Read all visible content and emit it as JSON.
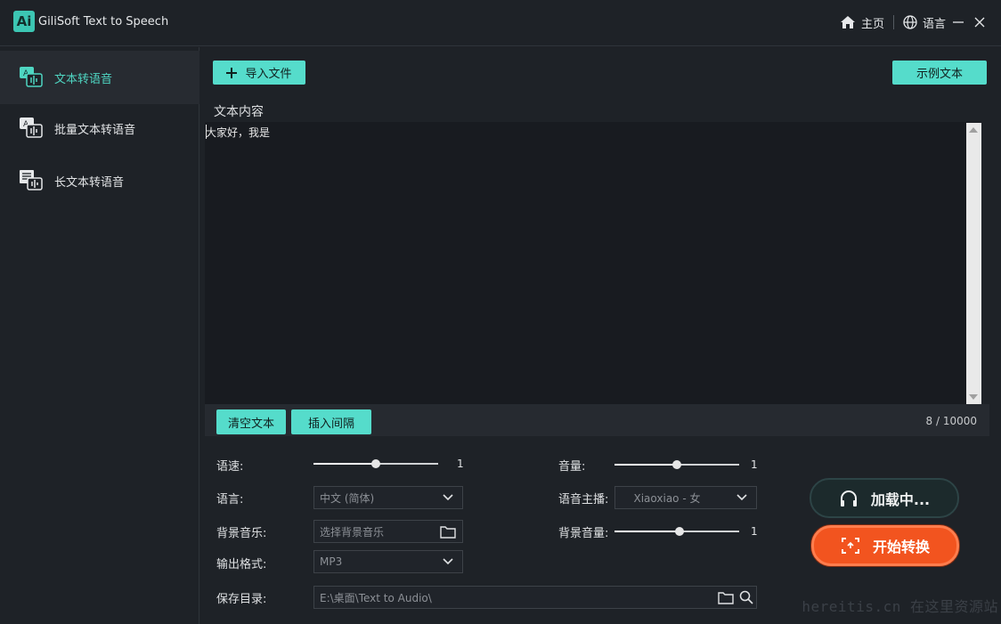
{
  "app": {
    "logo_text": "Ai",
    "title": "GiliSoft Text to Speech"
  },
  "titlebar": {
    "home_label": "主页",
    "language_label": "语言",
    "minimize_glyph": "—",
    "close_glyph": "✕"
  },
  "sidebar": {
    "items": [
      {
        "label": "文本转语音",
        "active": true
      },
      {
        "label": "批量文本转语音",
        "active": false
      },
      {
        "label": "长文本转语音",
        "active": false
      }
    ]
  },
  "toolbar": {
    "import_label": "导入文件",
    "sample_label": "示例文本"
  },
  "editor": {
    "section_label": "文本内容",
    "text": "大家好，我是",
    "clear_label": "清空文本",
    "insert_pause_label": "插入间隔",
    "counter": "8 / 10000",
    "counter_max": 10000,
    "counter_value": 8
  },
  "settings": {
    "speed": {
      "label": "语速:",
      "value": "1",
      "fraction": 0.5
    },
    "volume": {
      "label": "音量:",
      "value": "1",
      "fraction": 0.5
    },
    "language": {
      "label": "语言:",
      "value": "中文 (简体)"
    },
    "voice": {
      "label": "语音主播:",
      "value": "Xiaoxiao - 女"
    },
    "bg_music": {
      "label": "背景音乐:",
      "placeholder": "选择背景音乐"
    },
    "bg_volume": {
      "label": "背景音量:",
      "value": "1",
      "fraction": 0.52
    },
    "format": {
      "label": "输出格式:",
      "value": "MP3"
    },
    "save_dir": {
      "label": "保存目录:",
      "value": "E:\\桌面\\Text to Audio\\"
    }
  },
  "actions": {
    "loading_label": "加载中...",
    "convert_label": "开始转换"
  },
  "watermark": "hereitis.cn 在这里资源站",
  "colors": {
    "accent": "#55dccb",
    "convert": "#f2541f",
    "background": "#1e2227"
  }
}
